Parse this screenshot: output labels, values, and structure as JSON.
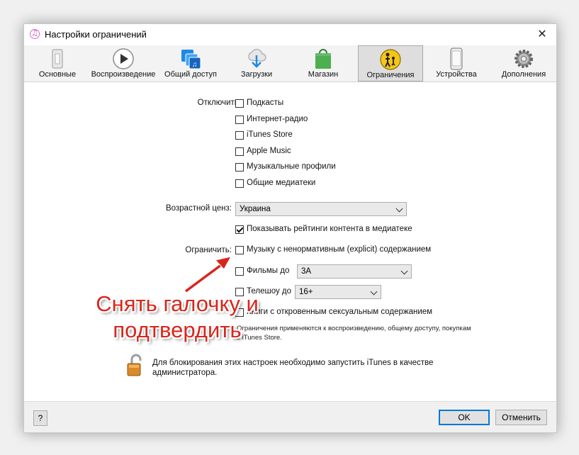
{
  "window": {
    "title": "Настройки ограничений",
    "close": "✕"
  },
  "toolbar": {
    "items": [
      {
        "label": "Основные",
        "icon": "general-icon"
      },
      {
        "label": "Воспроизведение",
        "icon": "play-icon"
      },
      {
        "label": "Общий доступ",
        "icon": "sharing-icon"
      },
      {
        "label": "Загрузки",
        "icon": "download-icon"
      },
      {
        "label": "Магазин",
        "icon": "store-bag-icon"
      },
      {
        "label": "Ограничения",
        "icon": "parental-restrictions-icon",
        "selected": true
      },
      {
        "label": "Устройства",
        "icon": "device-icon"
      },
      {
        "label": "Дополнения",
        "icon": "gear-icon"
      }
    ]
  },
  "disable": {
    "label": "Отключить:",
    "options": [
      {
        "label": "Подкасты",
        "checked": false
      },
      {
        "label": "Интернет-радио",
        "checked": false
      },
      {
        "label": "iTunes Store",
        "checked": false
      },
      {
        "label": "Apple Music",
        "checked": false
      },
      {
        "label": "Музыкальные профили",
        "checked": false
      },
      {
        "label": "Общие медиатеки",
        "checked": false
      }
    ]
  },
  "ratings": {
    "label": "Возрастной ценз:",
    "value": "Украина",
    "show_ratings_label": "Показывать рейтинги контента в медиатеке",
    "show_ratings_checked": true
  },
  "restrict": {
    "label": "Ограничить:",
    "explicit_music": "Музыку с ненормативным (explicit) содержанием",
    "movies_label": "Фильмы до",
    "movies_value": "3А",
    "tv_label": "Телешоу до",
    "tv_value": "16+",
    "books_label": "Книги с откровенным сексуальным содержанием",
    "note_line1": "Ограничения применяются к воспроизведению, общему доступу, покупкам",
    "note_line2": "в iTunes Store."
  },
  "lock_message": {
    "line1": "Для блокирования этих настроек необходимо запустить iTunes в качестве",
    "line2": "администратора."
  },
  "footer": {
    "help": "?",
    "ok": "OK",
    "cancel": "Отменить"
  },
  "annotation": {
    "line1": "Снять галочку и",
    "line2": "подтвердить",
    "color": "#d8261c"
  }
}
